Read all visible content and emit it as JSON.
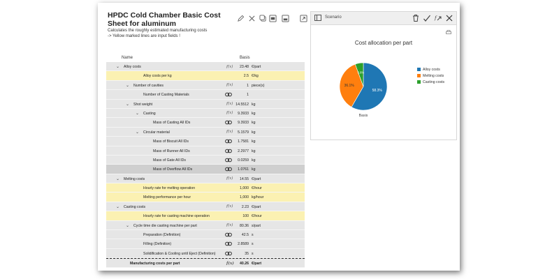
{
  "sheet": {
    "title": "HPDC Cold Chamber Basic Cost Sheet for aluminum",
    "description_1": "Calculates the roughly estimated manufacturing costs",
    "description_2": "-> Yellow marked lines are input fields !"
  },
  "table": {
    "col_name": "Name",
    "col_basis": "Basis",
    "rows": [
      {
        "label": "Alloy costs",
        "level": 0,
        "chev": "v",
        "icon": "fx",
        "value": "23.48",
        "unit": "€/part",
        "type": "group"
      },
      {
        "label": "Alloy costs per kg",
        "level": 1,
        "chev": "",
        "icon": "",
        "value": "2.5",
        "unit": "€/kg",
        "type": "input"
      },
      {
        "label": "Number of cavities",
        "level": 1,
        "chev": "v",
        "icon": "fx",
        "value": "1",
        "unit": "piece(s)",
        "type": "group"
      },
      {
        "label": "Number of Casting Materials",
        "level": 2,
        "chev": "",
        "icon": "link",
        "value": "1",
        "unit": "",
        "type": "group"
      },
      {
        "label": "Shot weight",
        "level": 1,
        "chev": "v",
        "icon": "fx",
        "value": "14.5512",
        "unit": "kg",
        "type": "group"
      },
      {
        "label": "Casting",
        "level": 2,
        "chev": "v",
        "icon": "fx",
        "value": "9.3933",
        "unit": "kg",
        "type": "group"
      },
      {
        "label": "Mass of Casting All IDs",
        "level": 3,
        "chev": "",
        "icon": "link",
        "value": "9.3933",
        "unit": "kg",
        "type": "group"
      },
      {
        "label": "Circular material",
        "level": 2,
        "chev": "v",
        "icon": "fx",
        "value": "5.1579",
        "unit": "kg",
        "type": "group"
      },
      {
        "label": "Mass of Biscuit All IDs",
        "level": 3,
        "chev": "",
        "icon": "link",
        "value": "1.7581",
        "unit": "kg",
        "type": "group"
      },
      {
        "label": "Mass of Runner All IDs",
        "level": 3,
        "chev": "",
        "icon": "link",
        "value": "2.2977",
        "unit": "kg",
        "type": "group"
      },
      {
        "label": "Mass of Gate All IDs",
        "level": 3,
        "chev": "",
        "icon": "link",
        "value": "0.0259",
        "unit": "kg",
        "type": "group"
      },
      {
        "label": "Mass of Overflow All IDs",
        "level": 3,
        "chev": "",
        "icon": "link",
        "value": "1.0761",
        "unit": "kg",
        "type": "dark"
      },
      {
        "label": "Melting costs",
        "level": 0,
        "chev": "v",
        "icon": "fx",
        "value": "14.55",
        "unit": "€/part",
        "type": "group"
      },
      {
        "label": "Hourly rate for melting operation",
        "level": 1,
        "chev": "",
        "icon": "",
        "value": "1,000",
        "unit": "€/hour",
        "type": "input"
      },
      {
        "label": "Melting performance per hour",
        "level": 1,
        "chev": "",
        "icon": "",
        "value": "1,000",
        "unit": "kg/hour",
        "type": "input"
      },
      {
        "label": "Casting costs",
        "level": 0,
        "chev": "v",
        "icon": "fx",
        "value": "2.23",
        "unit": "€/part",
        "type": "group"
      },
      {
        "label": "Hourly rate for casting machine operation",
        "level": 1,
        "chev": "",
        "icon": "",
        "value": "100",
        "unit": "€/hour",
        "type": "input"
      },
      {
        "label": "Cycle time die casting machine per part",
        "level": 1,
        "chev": "v",
        "icon": "fx",
        "value": "80.36",
        "unit": "s/part",
        "type": "group"
      },
      {
        "label": "Preparation (Definition)",
        "level": 2,
        "chev": "",
        "icon": "link",
        "value": "42.5",
        "unit": "s",
        "type": "group"
      },
      {
        "label": "Filling (Definition)",
        "level": 2,
        "chev": "",
        "icon": "link",
        "value": "2.8589",
        "unit": "s",
        "type": "group"
      },
      {
        "label": "Solidification & Cooling until Eject (Definition)",
        "level": 2,
        "chev": "",
        "icon": "link",
        "value": "35",
        "unit": "s",
        "type": "group"
      }
    ],
    "total": {
      "label": "Manufacturing costs per part",
      "value": "40.26",
      "unit": "€/part"
    }
  },
  "scenario": {
    "title": "Scenario"
  },
  "chart_data": {
    "type": "pie",
    "title": "Cost allocation per part",
    "categories": [
      "Basis"
    ],
    "series": [
      {
        "name": "Alloy costs",
        "value": 58.3,
        "label": "58.3%",
        "color": "#1f77b4"
      },
      {
        "name": "Melting costs",
        "value": 36.1,
        "label": "36.1%",
        "color": "#ff7f0e"
      },
      {
        "name": "Casting costs",
        "value": 5.6,
        "label": "5.6%",
        "color": "#2ca02c"
      }
    ],
    "legend_position": "right"
  }
}
